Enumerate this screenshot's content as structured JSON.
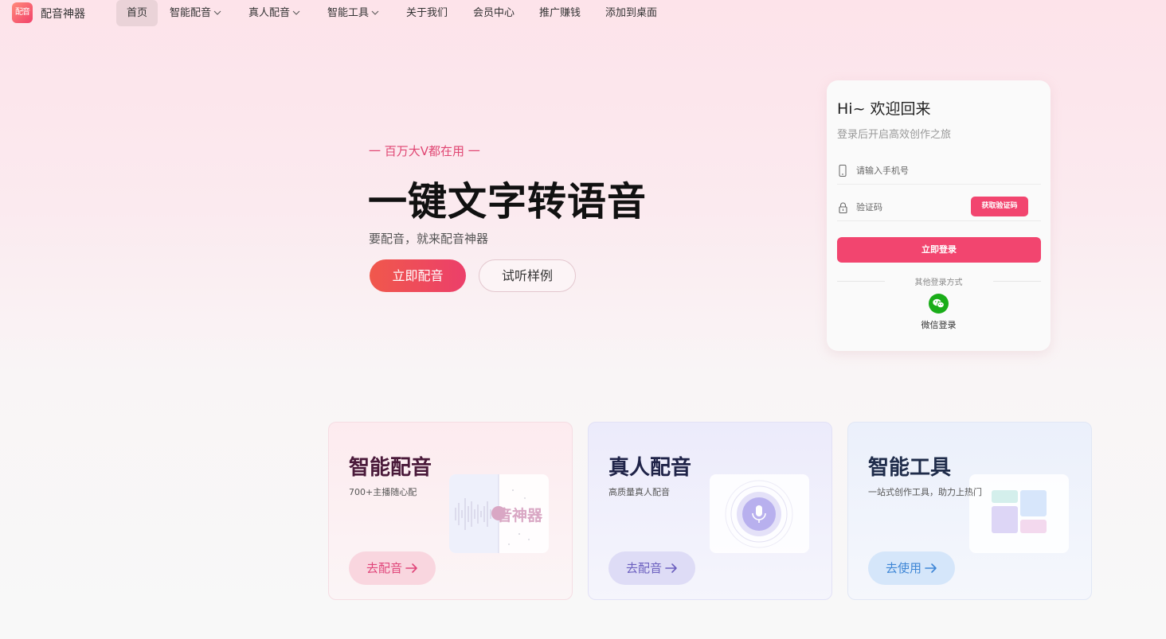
{
  "brand": {
    "logo_text": "配音",
    "name": "配音神器"
  },
  "nav": {
    "items": [
      {
        "label": "首页"
      },
      {
        "label": "智能配音"
      },
      {
        "label": "真人配音"
      },
      {
        "label": "智能工具"
      },
      {
        "label": "关于我们"
      },
      {
        "label": "会员中心"
      },
      {
        "label": "推广赚钱"
      },
      {
        "label": "添加到桌面"
      }
    ]
  },
  "hero": {
    "tagline": "一 百万大V都在用 一",
    "headline": "一键文字转语音",
    "subline": "要配音，就来配音神器",
    "primary_button": "立即配音",
    "secondary_button": "试听样例"
  },
  "login": {
    "title": "Hi~ 欢迎回来",
    "subtitle": "登录后开启高效创作之旅",
    "phone_placeholder": "请输入手机号",
    "code_placeholder": "验证码",
    "get_code_button": "获取验证码",
    "login_button": "立即登录",
    "other_methods": "其他登录方式",
    "wechat_label": "微信登录"
  },
  "cards": [
    {
      "title": "智能配音",
      "desc": "700+主播随心配",
      "button": "去配音",
      "visual_text": "音神器"
    },
    {
      "title": "真人配音",
      "desc": "高质量真人配音",
      "button": "去配音"
    },
    {
      "title": "智能工具",
      "desc": "一站式创作工具，助力上热门",
      "button": "去使用"
    }
  ],
  "colors": {
    "accent": "#f2456f",
    "wechat": "#1aad19"
  }
}
